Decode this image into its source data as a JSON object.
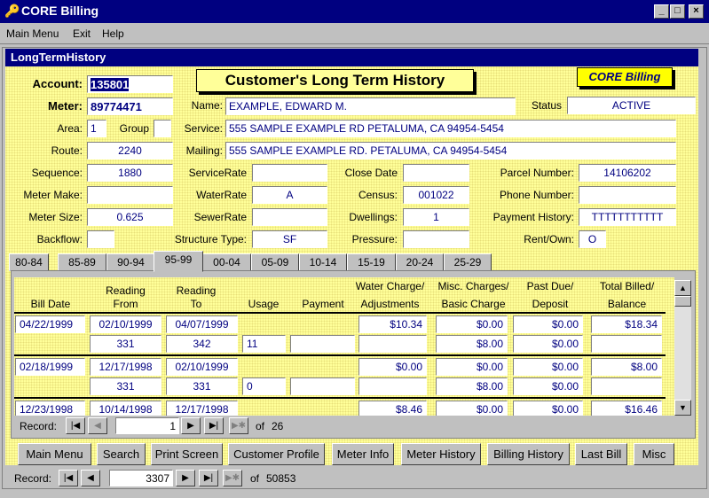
{
  "window": {
    "title": "CORE Billing",
    "minimize": "_",
    "maximize": "□",
    "close": "×"
  },
  "menu": {
    "main_menu": "Main Menu",
    "exit": "Exit",
    "help": "Help"
  },
  "form": {
    "title": "LongTermHistory",
    "header": "Customer's Long Term History",
    "brand": "CORE Billing",
    "labels": {
      "account": "Account:",
      "meter": "Meter:",
      "name": "Name:",
      "status": "Status",
      "area": "Area:",
      "group": "Group",
      "service": "Service:",
      "route": "Route:",
      "mailing": "Mailing:",
      "sequence": "Sequence:",
      "service_rate": "ServiceRate",
      "close_date": "Close Date",
      "parcel_number": "Parcel Number:",
      "meter_make": "Meter Make:",
      "water_rate": "WaterRate",
      "census": "Census:",
      "phone_number": "Phone Number:",
      "meter_size": "Meter Size:",
      "sewer_rate": "SewerRate",
      "dwellings": "Dwellings:",
      "payment_history": "Payment History:",
      "backflow": "Backflow:",
      "structure_type": "Structure Type:",
      "pressure": "Pressure:",
      "rent_own": "Rent/Own:"
    },
    "values": {
      "account": "135801",
      "meter": "89774471",
      "name": "EXAMPLE, EDWARD M.",
      "status": "ACTIVE",
      "area": "1",
      "group": "",
      "service": "555 SAMPLE EXAMPLE RD PETALUMA, CA 94954-5454",
      "route": "2240",
      "mailing": "555 SAMPLE EXAMPLE RD. PETALUMA, CA  94954-5454",
      "sequence": "1880",
      "service_rate": "",
      "close_date": "",
      "parcel_number": "14106202",
      "meter_make": "",
      "water_rate": "A",
      "census": "001022",
      "phone_number": "",
      "meter_size": "0.625",
      "sewer_rate": "",
      "dwellings": "1",
      "payment_history": "TTTTTTTTTTT",
      "backflow": "",
      "structure_type": "SF",
      "pressure": "",
      "rent_own": "O"
    }
  },
  "tabs": [
    "80-84",
    "85-89",
    "90-94",
    "95-99",
    "00-04",
    "05-09",
    "10-14",
    "15-19",
    "20-24",
    "25-29"
  ],
  "active_tab": "95-99",
  "history": {
    "headers": {
      "bill_date": "Bill Date",
      "reading_from": [
        "Reading",
        "From"
      ],
      "reading_to": [
        "Reading",
        "To"
      ],
      "usage": "Usage",
      "payment": "Payment",
      "water_charge": [
        "Water Charge/",
        "Adjustments"
      ],
      "misc_charges": [
        "Misc. Charges/",
        "Basic Charge"
      ],
      "past_due": [
        "Past Due/",
        "Deposit"
      ],
      "total_billed": [
        "Total Billed/",
        "Balance"
      ]
    },
    "records": [
      {
        "bill_date": "04/22/1999",
        "from_date": "02/10/1999",
        "to_date": "04/07/1999",
        "from_read": "331",
        "to_read": "342",
        "usage": "11",
        "payment": "",
        "water_charge": "$10.34",
        "adjustments": "",
        "misc_charges": "$0.00",
        "basic_charge": "$8.00",
        "past_due": "$0.00",
        "deposit": "$0.00",
        "total_billed": "$18.34",
        "balance": ""
      },
      {
        "bill_date": "02/18/1999",
        "from_date": "12/17/1998",
        "to_date": "02/10/1999",
        "from_read": "331",
        "to_read": "331",
        "usage": "0",
        "payment": "",
        "water_charge": "$0.00",
        "adjustments": "",
        "misc_charges": "$0.00",
        "basic_charge": "$8.00",
        "past_due": "$0.00",
        "deposit": "$0.00",
        "total_billed": "$8.00",
        "balance": ""
      },
      {
        "bill_date": "12/23/1998",
        "from_date": "10/14/1998",
        "to_date": "12/17/1998",
        "from_read": "",
        "to_read": "",
        "usage": "",
        "payment": "",
        "water_charge": "$8.46",
        "adjustments": "",
        "misc_charges": "$0.00",
        "basic_charge": "",
        "past_due": "$0.00",
        "deposit": "",
        "total_billed": "$16.46",
        "balance": ""
      }
    ],
    "nav": {
      "label": "Record:",
      "current": "1",
      "of": "of",
      "total": "26"
    }
  },
  "buttons": [
    "Main Menu",
    "Search",
    "Print Screen",
    "Customer Profile",
    "Meter Info",
    "Meter History",
    "Billing History",
    "Last Bill",
    "Misc"
  ],
  "main_nav": {
    "label": "Record:",
    "current": "3307",
    "of": "of",
    "total": "50853"
  },
  "nav_glyphs": {
    "first": "|◀",
    "prev": "◀",
    "next": "▶",
    "last": "▶|",
    "new": "▶✱"
  },
  "scroll_glyphs": {
    "up": "▲",
    "down": "▼"
  }
}
